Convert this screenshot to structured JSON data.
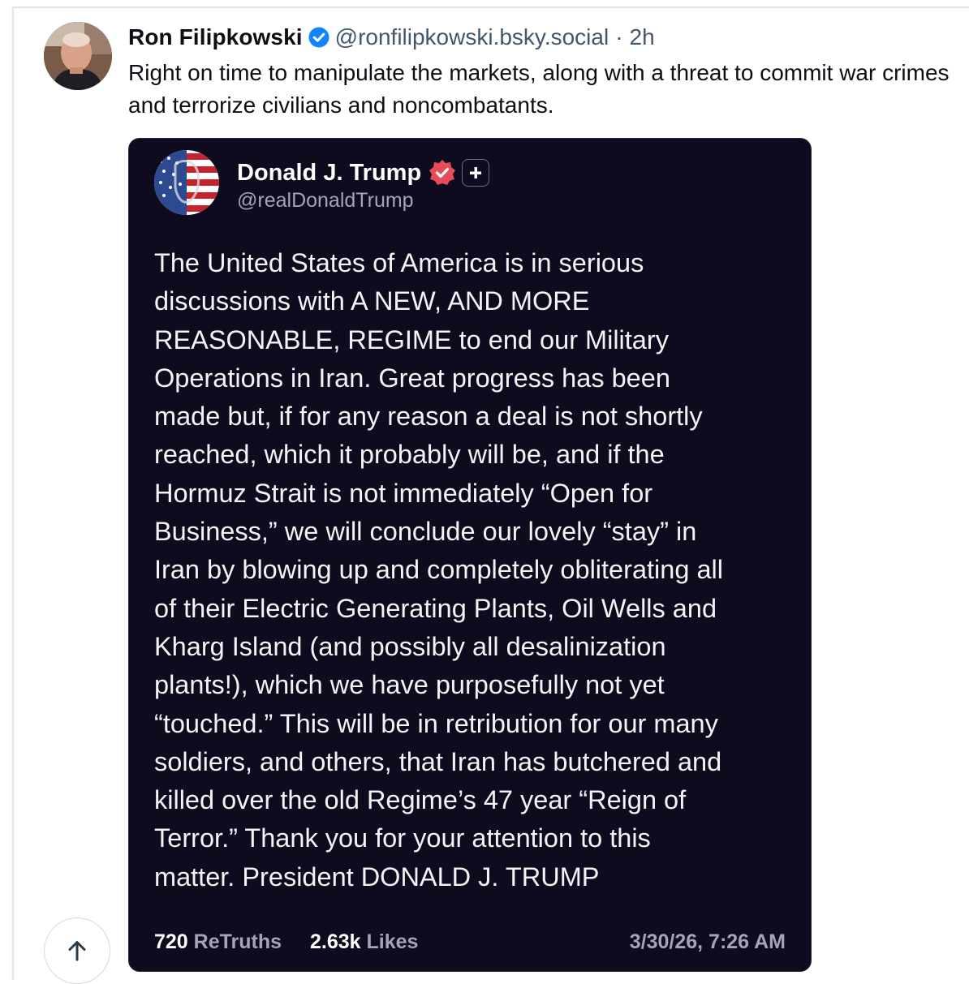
{
  "post": {
    "author_name": "Ron Filipkowski",
    "handle": "@ronfilipkowski.bsky.social",
    "separator": "·",
    "time": "2h",
    "text": "Right on time to manipulate the markets, along with a threat to commit war crimes and terrorize civilians and noncombatants.",
    "icons": {
      "avatar": "author-avatar",
      "verified": "verified-check-icon"
    },
    "colors": {
      "verified": "#1185fe",
      "muted": "#42576c"
    }
  },
  "embed": {
    "name": "Donald J. Trump",
    "handle": "@realDonaldTrump",
    "body_lines": [
      "The United States of America is in serious",
      "discussions with A NEW, AND MORE",
      "REASONABLE, REGIME to end our Military",
      "Operations in Iran. Great progress has been",
      "made but, if for any reason a deal is not shortly",
      "reached, which it probably will be, and if the",
      "Hormuz Strait is not immediately “Open for",
      "Business,” we will conclude our lovely “stay” in",
      "Iran by blowing up and completely obliterating all",
      "of their Electric Generating Plants, Oil Wells and",
      "Kharg Island (and possibly all desalinization",
      "plants!), which we have purposefully not yet",
      "“touched.” This will be in retribution for our many",
      "soldiers, and others, that Iran has butchered and",
      "killed over the old Regime’s 47 year “Reign of",
      "Terror.” Thank you for your attention to this",
      "matter. President DONALD J. TRUMP"
    ],
    "retruths_count": "720",
    "retruths_label": "ReTruths",
    "likes_count": "2.63k",
    "likes_label": "Likes",
    "date": "3/30/26, 7:26 AM",
    "colors": {
      "background": "#0d0b1d",
      "badge": "#e94a5a"
    }
  },
  "scroll_top": {
    "icon": "arrow-up-icon"
  }
}
